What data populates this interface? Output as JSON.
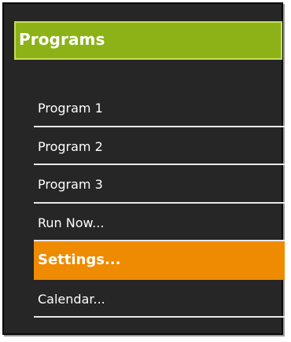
{
  "panel": {
    "title": "Programs"
  },
  "menu": {
    "items": [
      {
        "label": "Program 1",
        "active": false
      },
      {
        "label": "Program 2",
        "active": false
      },
      {
        "label": "Program 3",
        "active": false
      },
      {
        "label": "Run Now...",
        "active": false
      },
      {
        "label": "Settings...",
        "active": true
      },
      {
        "label": "Calendar...",
        "active": false
      }
    ]
  },
  "colors": {
    "panel_background": "#262626",
    "header_background": "#8db218",
    "header_border": "#c7dd58",
    "active_item": "#ef8b00",
    "divider": "#e8e8e8",
    "text": "#ffffff"
  }
}
